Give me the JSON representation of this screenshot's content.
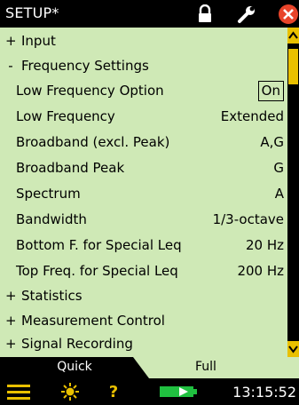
{
  "window": {
    "title": "SETUP*"
  },
  "toolbar": {
    "icons": [
      "lock-icon",
      "wrench-icon",
      "close-icon"
    ]
  },
  "setup": {
    "groups": [
      {
        "symbol": "+",
        "label": "Input"
      },
      {
        "symbol": "-",
        "label": "Frequency Settings"
      },
      {
        "symbol": "+",
        "label": "Statistics"
      },
      {
        "symbol": "+",
        "label": "Measurement Control"
      },
      {
        "symbol": "+",
        "label": "Signal Recording"
      }
    ],
    "params": [
      {
        "label": "Low Frequency Option",
        "value": "On"
      },
      {
        "label": "Low Frequency",
        "value": "Extended"
      },
      {
        "label": "Broadband (excl. Peak)",
        "value": "A,G"
      },
      {
        "label": "Broadband Peak",
        "value": "G"
      },
      {
        "label": "Spectrum",
        "value": "A"
      },
      {
        "label": "Bandwidth",
        "value": "1/3-octave"
      },
      {
        "label": "Bottom F. for Special Leq",
        "value": "20 Hz"
      },
      {
        "label": "Top Freq. for Special Leq",
        "value": "200 Hz"
      }
    ]
  },
  "tabs": [
    {
      "label": "Quick"
    },
    {
      "label": "Full"
    }
  ],
  "status": {
    "time": "13:15:52",
    "icons": [
      "menu-icon",
      "sun-icon",
      "help-icon",
      "battery-icon"
    ]
  },
  "colors": {
    "panel": "#cfe9b6",
    "accent": "#e9c000",
    "close": "#e8442a",
    "battery": "#20c040"
  }
}
